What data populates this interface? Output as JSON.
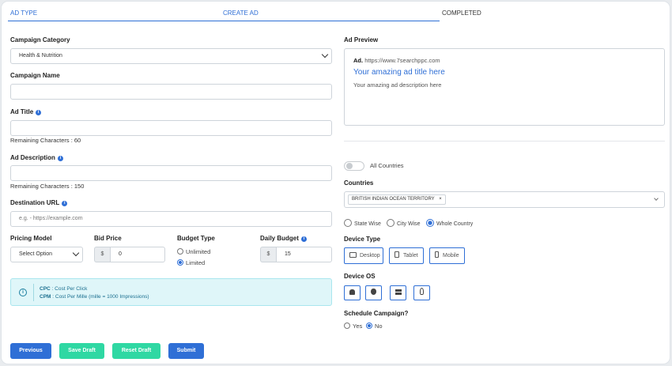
{
  "tabs": [
    "AD TYPE",
    "CREATE AD",
    "COMPLETED"
  ],
  "form": {
    "category_label": "Campaign Category",
    "category_value": "Health & Nutrition",
    "name_label": "Campaign Name",
    "title_label": "Ad Title",
    "title_remaining": "Remaining Characters : 60",
    "desc_label": "Ad Description",
    "desc_remaining": "Remaining Characters : 150",
    "url_label": "Destination URL",
    "url_placeholder": "e.g. - https://example.com",
    "pricing_label": "Pricing Model",
    "pricing_value": "Select Option",
    "bid_label": "Bid Price",
    "bid_prefix": "$",
    "bid_value": "0",
    "budget_type_label": "Budget Type",
    "budget_unlimited": "Unlimited",
    "budget_limited": "Limited",
    "daily_label": "Daily Budget",
    "daily_prefix": "$",
    "daily_value": "15"
  },
  "info_box": {
    "cpc_key": "CPC",
    "cpc_text": ": Cost Per Click",
    "cpm_key": "CPM",
    "cpm_text": ": Cost Per Mille (mille = 1000 Impressions)"
  },
  "preview": {
    "label": "Ad Preview",
    "ad_tag": "Ad.",
    "url": "https://www.7searchppc.com",
    "title": "Your amazing ad title here",
    "description": "Your amazing ad description here"
  },
  "targeting": {
    "all_countries_label": "All Countries",
    "countries_label": "Countries",
    "country_chip": "BRITISH INDIAN OCEAN TERRITORY",
    "chip_close": "×",
    "state_wise": "State Wise",
    "city_wise": "City Wise",
    "whole_country": "Whole Country",
    "device_type_label": "Device Type",
    "devices": [
      "Desktop",
      "Tablet",
      "Mobile"
    ],
    "device_os_label": "Device OS",
    "os_icons": [
      "android-icon",
      "apple-icon",
      "windows-icon",
      "linux-icon"
    ],
    "schedule_label": "Schedule Campaign?",
    "schedule_yes": "Yes",
    "schedule_no": "No"
  },
  "buttons": {
    "previous": "Previous",
    "save_draft": "Save Draft",
    "reset_draft": "Reset Draft",
    "submit": "Submit"
  },
  "colors": {
    "primary": "#2f6fd6",
    "success": "#2fd8a3",
    "info_bg": "#dff6f9",
    "info_border": "#a9e6ee"
  }
}
